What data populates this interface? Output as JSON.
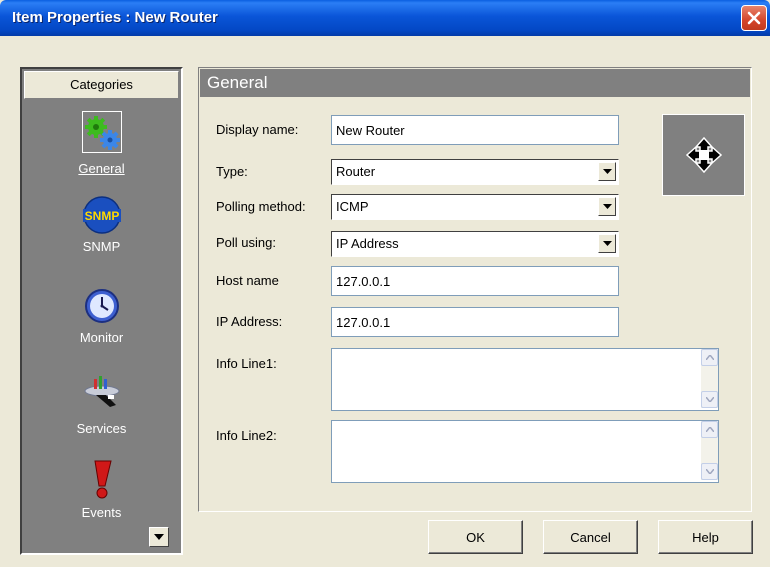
{
  "window": {
    "title": "Item Properties : New Router"
  },
  "sidebar": {
    "header": "Categories",
    "items": [
      {
        "label": "General",
        "icon": "gears-icon",
        "selected": true
      },
      {
        "label": "SNMP",
        "icon": "snmp-icon"
      },
      {
        "label": "Monitor",
        "icon": "clock-icon"
      },
      {
        "label": "Services",
        "icon": "services-tray-icon"
      },
      {
        "label": "Events",
        "icon": "exclamation-icon"
      }
    ]
  },
  "panel": {
    "title": "General",
    "fields": {
      "display_name": {
        "label": "Display name:",
        "value": "New Router"
      },
      "type": {
        "label": "Type:",
        "value": "Router"
      },
      "polling_method": {
        "label": "Polling method:",
        "value": "ICMP"
      },
      "poll_using": {
        "label": "Poll using:",
        "value": "IP Address"
      },
      "host_name": {
        "label": "Host name",
        "value": "127.0.0.1"
      },
      "ip_address": {
        "label": "IP Address:",
        "value": "127.0.0.1"
      },
      "info_line1": {
        "label": "Info Line1:",
        "value": ""
      },
      "info_line2": {
        "label": "Info Line2:",
        "value": ""
      }
    },
    "device_icon": "move-arrows-icon"
  },
  "buttons": {
    "ok": "OK",
    "cancel": "Cancel",
    "help": "Help"
  },
  "colors": {
    "titlebar": "#0a55d8",
    "panel_gray": "#808080",
    "dialog_bg": "#ece9d8"
  }
}
